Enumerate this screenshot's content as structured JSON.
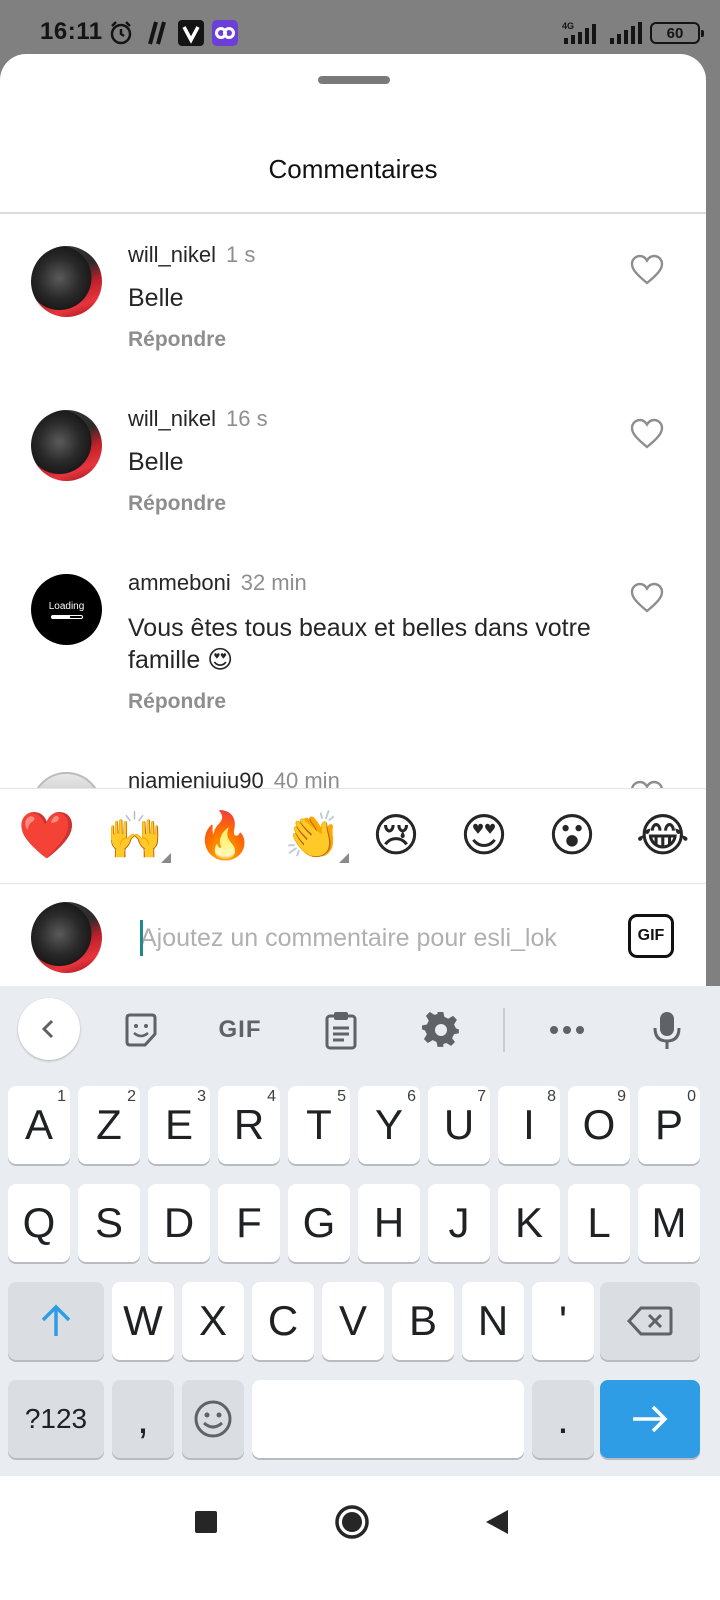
{
  "status_bar": {
    "time": "16:11",
    "icons": [
      "alarm-icon",
      "app-icon-slash",
      "app-icon-v",
      "app-icon-infinity"
    ],
    "network": "4G",
    "battery": "60"
  },
  "sheet": {
    "title": "Commentaires"
  },
  "comments": [
    {
      "username": "will_nikel",
      "time": "1 s",
      "text": "Belle",
      "reply_label": "Répondre"
    },
    {
      "username": "will_nikel",
      "time": "16 s",
      "text": "Belle",
      "reply_label": "Répondre"
    },
    {
      "username": "ammeboni",
      "time": "32 min",
      "text": "Vous êtes tous beaux et belles dans votre famille 😍",
      "reply_label": "Répondre",
      "avatar_text": "Loading"
    },
    {
      "username": "niamieniuiu90",
      "time": "40 min"
    }
  ],
  "emoji_bar": [
    "❤️",
    "🙌",
    "🔥",
    "👏",
    "😢",
    "😍",
    "😮",
    "😂"
  ],
  "input": {
    "placeholder": "Ajoutez un commentaire pour esli_lok",
    "gif_label": "GIF"
  },
  "keyboard": {
    "toolbar": [
      "back-icon",
      "sticker-icon",
      "GIF",
      "clipboard-icon",
      "settings-icon",
      "more-icon",
      "mic-icon"
    ],
    "toolbar_gif": "GIF",
    "row1": [
      {
        "k": "A",
        "n": "1"
      },
      {
        "k": "Z",
        "n": "2"
      },
      {
        "k": "E",
        "n": "3"
      },
      {
        "k": "R",
        "n": "4"
      },
      {
        "k": "T",
        "n": "5"
      },
      {
        "k": "Y",
        "n": "6"
      },
      {
        "k": "U",
        "n": "7"
      },
      {
        "k": "I",
        "n": "8"
      },
      {
        "k": "O",
        "n": "9"
      },
      {
        "k": "P",
        "n": "0"
      }
    ],
    "row2": [
      "Q",
      "S",
      "D",
      "F",
      "G",
      "H",
      "J",
      "K",
      "L",
      "M"
    ],
    "row3": [
      "W",
      "X",
      "C",
      "V",
      "B",
      "N",
      "'"
    ],
    "symbols_label": "?123",
    "comma": ",",
    "period": "."
  },
  "colors": {
    "accent": "#2e9de6",
    "heart": "#8e8e8e"
  }
}
